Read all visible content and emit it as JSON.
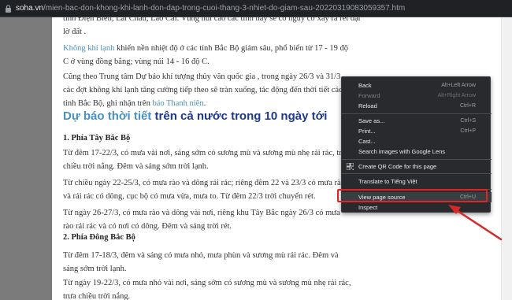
{
  "browser": {
    "url_host": "soha.vn",
    "url_path": "/mien-bac-don-khong-khi-lanh-don-dap-trong-cuoi-thang-3-nhiet-do-giam-sau-20220319083059357.htm"
  },
  "article": {
    "para_top_tail": "tỉnh Điện Biên, Lai Châu, Lào Cai. Vùng núi cao các tỉnh này sẽ có nguy cơ xảy ra rét đậm, rét hại.",
    "para_top_end": "lờ đất .",
    "para1_link": "Không khí lạnh",
    "para1_text": " khiến nền nhiệt độ ở các tỉnh Bắc Bộ giảm sâu, phổ biến từ 17 - 19 độ C ở vùng đồng bằng; vùng núi 14 - 16 độ C.",
    "para2_text": "Cũng theo Trung tâm Dự báo khí tượng thủy văn quốc gia , trong ngày 26/3 và 31/3, các đợt không khí lạnh tăng cường tiếp theo sẽ tràn xuống, tác động đến thời tiết các tỉnh Bắc Bộ, ghi nhận trên ",
    "para2_link": "báo Thanh niên",
    "para2_end": ".",
    "heading_link": "Dự báo thời tiết",
    "heading_text": " trên cả nước trong 10 ngày tới",
    "sub1": "1. Phía Tây Bắc Bộ",
    "p1": "Từ đêm 17-22/3, có mưa vài nơi, sáng sớm có sương mù và sương mù nhẹ rải rác, trưa chiều trời nắng. Đêm và sáng sớm trời lạnh.",
    "p2": "Từ chiều ngày 22-25/3, có mưa rào và dông rải rác; riêng đêm 22 và 23/3 có mưa rào và rải rác có dông, cục bộ có mưa vừa, mưa to. Từ đêm 22/3 trời chuyển rét.",
    "p3": "Từ ngày 26-27/3, có mưa rào và dông vài nơi, riêng khu Tây Bắc ngày 26/3 có mưa rào rải rác và có nơi có dông. Đêm và sáng trời rét.",
    "sub2": "2. Phía Đông Bắc Bộ",
    "p4": "Từ đêm 17-18/3, đêm và sáng có mưa nhỏ, mưa phùn và sương mù rải rác. Đêm và sáng sớm trời lạnh.",
    "p5": "Từ ngày 19-22/3, có mưa nhỏ vài nơi, sáng sớm có sương mù và sương mù nhẹ rải rác, trưa chiều trời nắng."
  },
  "context_menu": {
    "back": "Back",
    "back_sc": "Alt+Left Arrow",
    "forward": "Forward",
    "forward_sc": "Alt+Right Arrow",
    "reload": "Reload",
    "reload_sc": "Ctrl+R",
    "save_as": "Save as...",
    "save_as_sc": "Ctrl+S",
    "print": "Print...",
    "print_sc": "Ctrl+P",
    "cast": "Cast...",
    "search_images": "Search images with Google Lens",
    "qr": "Create QR Code for this page",
    "translate": "Translate to Tiếng Việt",
    "view_source": "View page source",
    "view_source_sc": "Ctrl+U",
    "inspect": "Inspect"
  },
  "colors": {
    "menu_bg": "#292a2d",
    "highlight": "#d92626",
    "link": "#4a90c2",
    "heading": "#1d3a8a"
  }
}
